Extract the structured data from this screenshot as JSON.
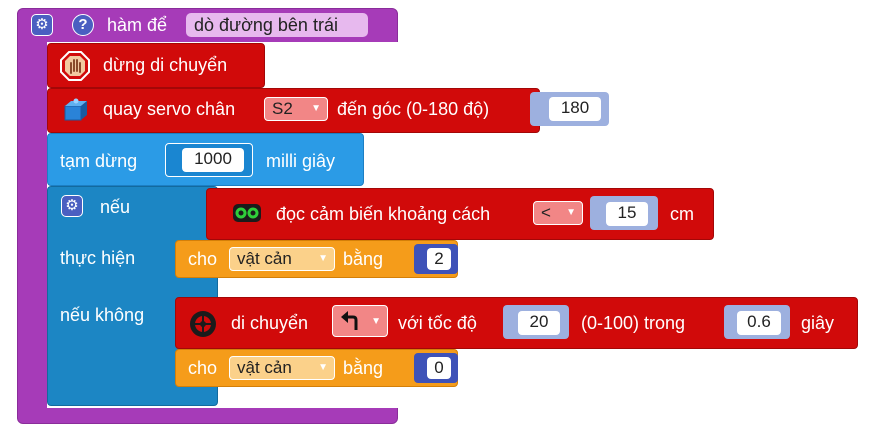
{
  "function_block": {
    "label": "hàm để",
    "name": "dò đường bên trái",
    "color": "#a63bb8"
  },
  "stop_block": {
    "label": "dừng di chuyển",
    "icon": "stop-hand-icon",
    "color": "#d10a0a"
  },
  "servo_block": {
    "label_prefix": "quay servo chân",
    "pin": "S2",
    "label_middle": "đến góc (0-180 độ)",
    "angle": "180",
    "icon": "servo-icon"
  },
  "pause_block": {
    "label": "tạm dừng",
    "value": "1000",
    "unit": "milli giây",
    "color": "#2b9be6"
  },
  "if_block": {
    "if_label": "nếu",
    "then_label": "thực hiện",
    "else_label": "nếu không",
    "color": "#1c86c4"
  },
  "sensor_block": {
    "label": "đọc cảm biến khoảng cách",
    "operator": "<",
    "value": "15",
    "unit": "cm",
    "icon": "ultrasonic-sensor-icon"
  },
  "set_var_1": {
    "label": "cho",
    "variable": "vật cản",
    "to_label": "bằng",
    "value": "2",
    "color": "#f59c1a"
  },
  "move_block": {
    "label": "di chuyển",
    "direction_icon": "turn-left-arrow-icon",
    "speed_label": "với tốc độ",
    "speed": "20",
    "range_label": "(0-100) trong",
    "duration": "0.6",
    "unit": "giây",
    "icon": "wheel-icon"
  },
  "set_var_2": {
    "label": "cho",
    "variable": "vật cản",
    "to_label": "bằng",
    "value": "0"
  },
  "colors": {
    "red": "#d10a0a",
    "purple": "#a63bb8",
    "blue_light": "#2b9be6",
    "blue_dark": "#1c86c4",
    "orange": "#f59c1a",
    "number_socket": "#3e52b8"
  }
}
